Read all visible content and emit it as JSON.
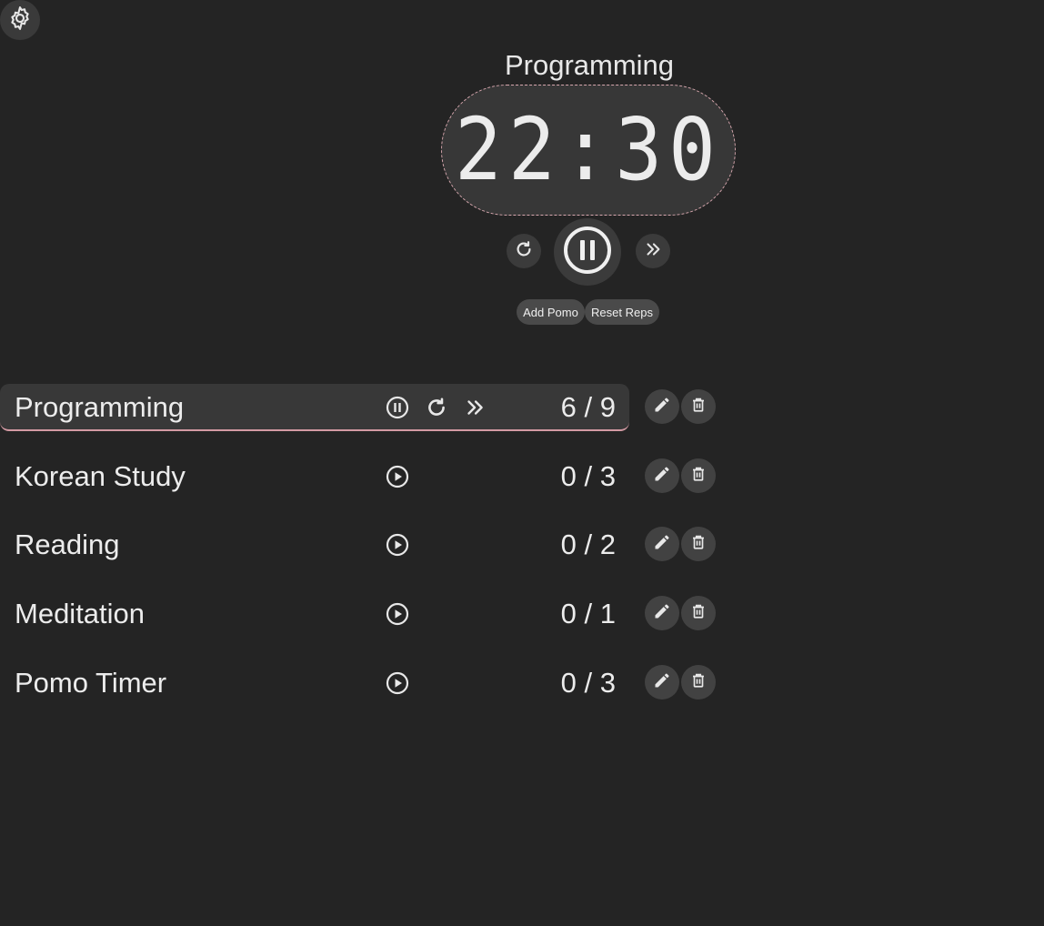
{
  "timer": {
    "task_title": "Programming",
    "time": "22:30"
  },
  "controls": {
    "reset_icon": "refresh-icon",
    "pause_icon": "pause-circle-icon",
    "skip_icon": "double-chevron-right-icon",
    "add_pomo_label": "Add Pomo",
    "reset_reps_label": "Reset Reps"
  },
  "settings": {
    "icon": "gear-icon"
  },
  "tasks": [
    {
      "name": "Programming",
      "count": "6 / 9",
      "active": true
    },
    {
      "name": "Korean Study",
      "count": "0 / 3",
      "active": false
    },
    {
      "name": "Reading",
      "count": "0 / 2",
      "active": false
    },
    {
      "name": "Meditation",
      "count": "0 / 1",
      "active": false
    },
    {
      "name": "Pomo Timer",
      "count": "0 / 3",
      "active": false
    }
  ],
  "colors": {
    "background": "#242424",
    "panel": "#383838",
    "accent": "#d39aa3",
    "text": "#ececec"
  }
}
